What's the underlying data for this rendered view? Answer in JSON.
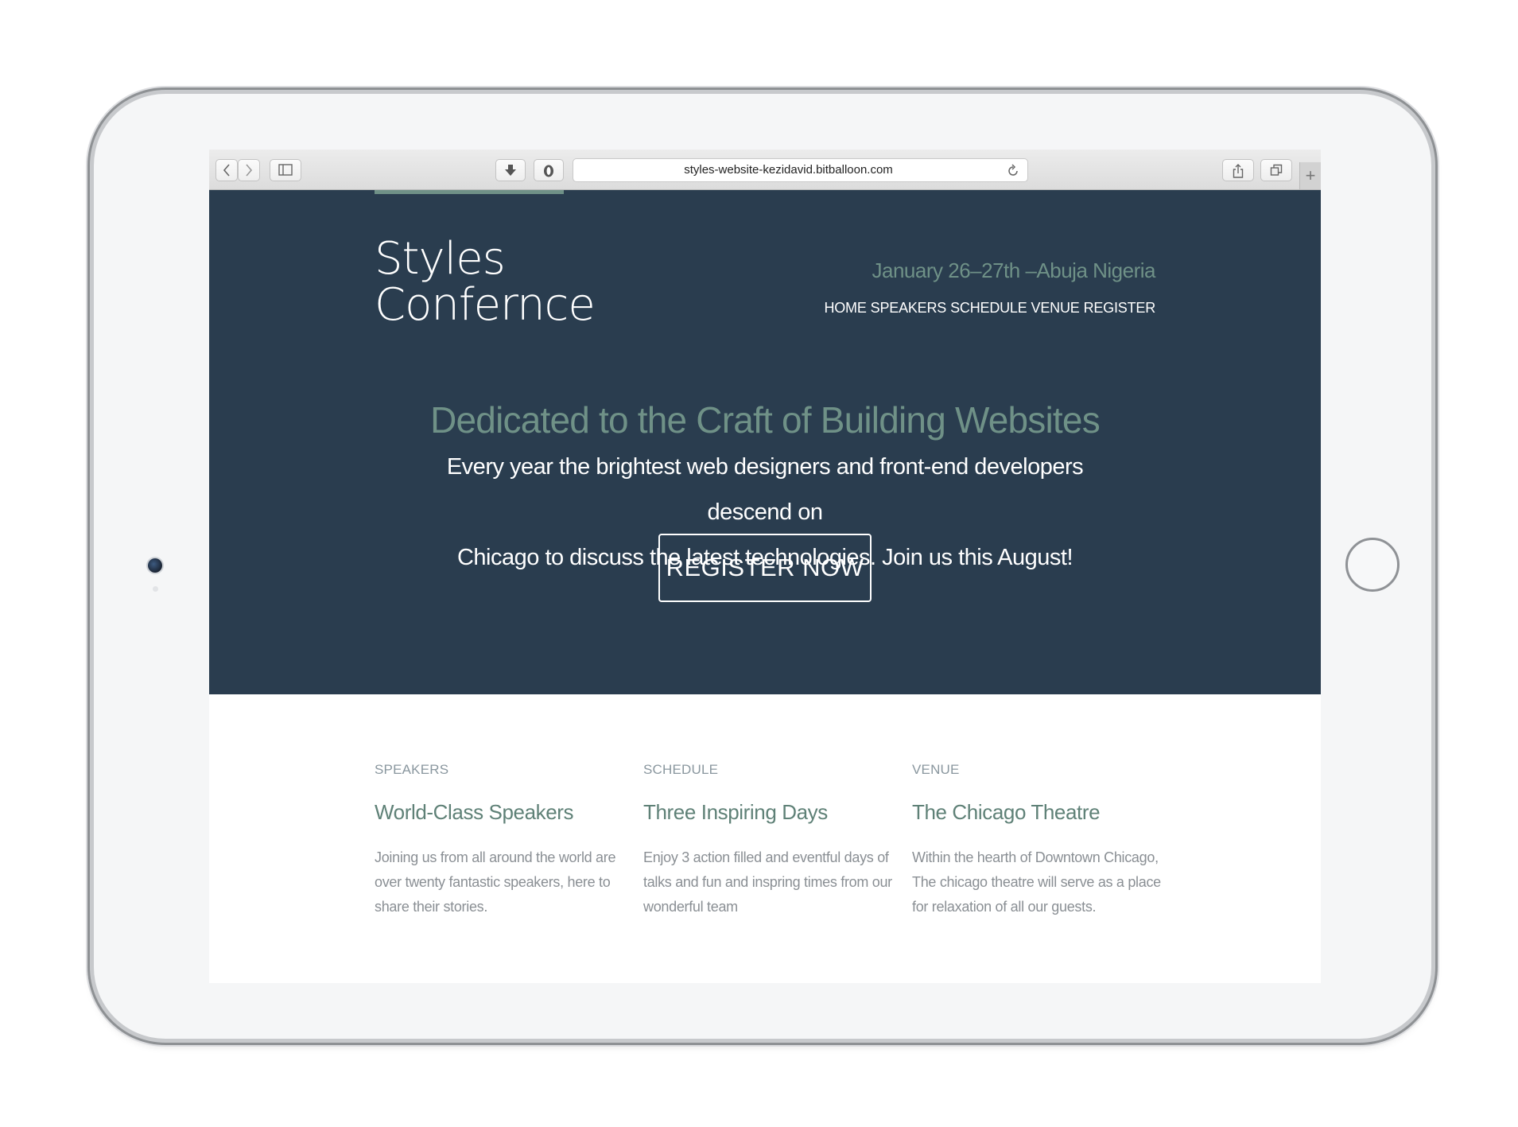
{
  "browser": {
    "url": "styles-website-kezidavid.bitballoon.com",
    "back_icon": "chevron-left-icon",
    "forward_icon": "chevron-right-icon",
    "sidebar_icon": "sidebar-icon",
    "download_icon": "download-icon",
    "extension_icon": "shield-icon",
    "reload_icon": "reload-icon",
    "share_icon": "share-icon",
    "tabs_icon": "tabs-icon",
    "new_tab_label": "+"
  },
  "site": {
    "logo_line1": "Styles",
    "logo_line2": "Confernce",
    "date_location": "January 26–27th –Abuja Nigeria",
    "nav": [
      "HOME",
      "SPEAKERS",
      "SCHEDULE",
      "VENUE",
      "REGISTER"
    ],
    "headline": "Dedicated to the Craft of Building Websites",
    "intro_line1": "Every year the brightest web designers and front-end developers descend on",
    "intro_line2": "Chicago to discuss the latest technologies. Join us this August!",
    "cta": "REGISTER NOW"
  },
  "features": [
    {
      "label": "SPEAKERS",
      "title": "World-Class Speakers",
      "desc_lines": [
        "Joining us from all around the world are",
        "over twenty fantastic speakers, here to",
        "share their stories."
      ]
    },
    {
      "label": "SCHEDULE",
      "title": "Three Inspiring Days",
      "desc_lines": [
        "Enjoy 3 action filled and eventful days of",
        "talks and fun and inspring times from our",
        "wonderful team"
      ]
    },
    {
      "label": "VENUE",
      "title": "The Chicago Theatre",
      "desc_lines": [
        "Within the hearth of Downtown Chicago,",
        "The chicago theatre will serve as a place",
        "for relaxation of all our guests."
      ]
    }
  ],
  "colors": {
    "hero_bg": "#2a3d4f",
    "accent": "#6f9187",
    "feature_title": "#5f8177"
  }
}
